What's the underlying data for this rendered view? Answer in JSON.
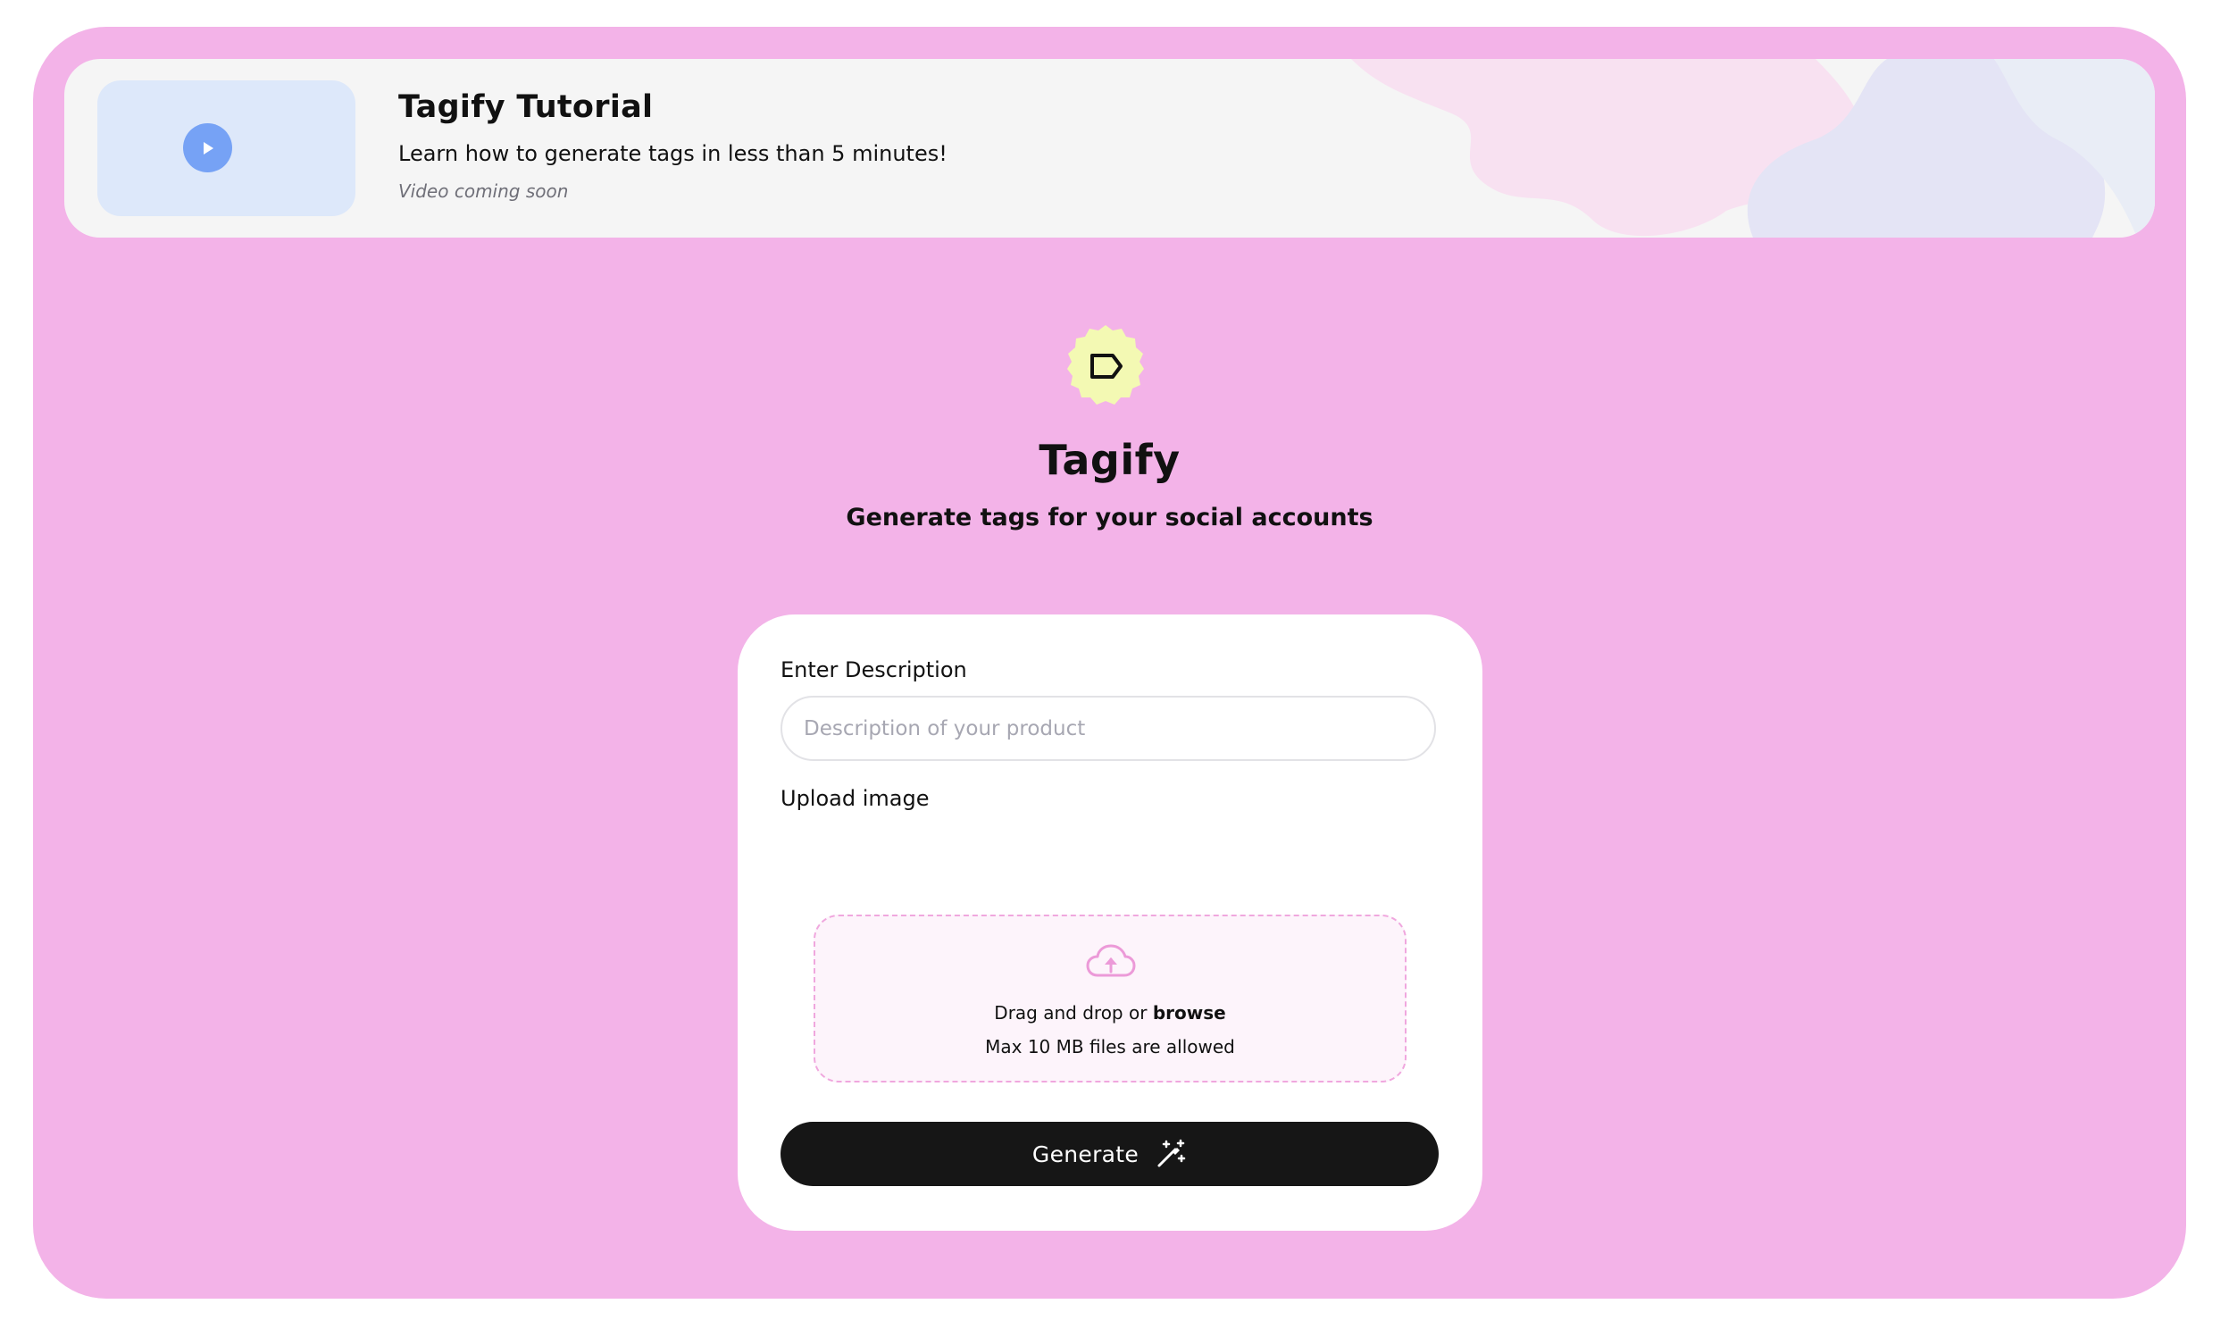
{
  "colors": {
    "background": "#f3b3e8",
    "banner": "#f5f5f5",
    "thumbnail": "#dde8fa",
    "play_button": "#76a2f5",
    "logo_badge": "#f3f9b3",
    "card": "#ffffff",
    "dropzone_border": "#f0a7de",
    "generate_button": "#161616"
  },
  "banner": {
    "title": "Tagify Tutorial",
    "subtitle": "Learn how to generate tags in less than 5 minutes!",
    "note": "Video coming soon",
    "icons": [
      "play-icon"
    ]
  },
  "hero": {
    "logo_icon": "tag-icon",
    "title": "Tagify",
    "subtitle": "Generate tags for your social accounts"
  },
  "form": {
    "description_label": "Enter Description",
    "description_placeholder": "Description of your product",
    "description_value": "",
    "upload_label": "Upload image",
    "dropzone": {
      "icon": "cloud-upload-icon",
      "drag_text": "Drag and drop or",
      "browse_text": "browse",
      "limit_text": "Max 10 MB files are allowed"
    },
    "generate_label": "Generate",
    "generate_icon": "magic-wand-icon"
  }
}
